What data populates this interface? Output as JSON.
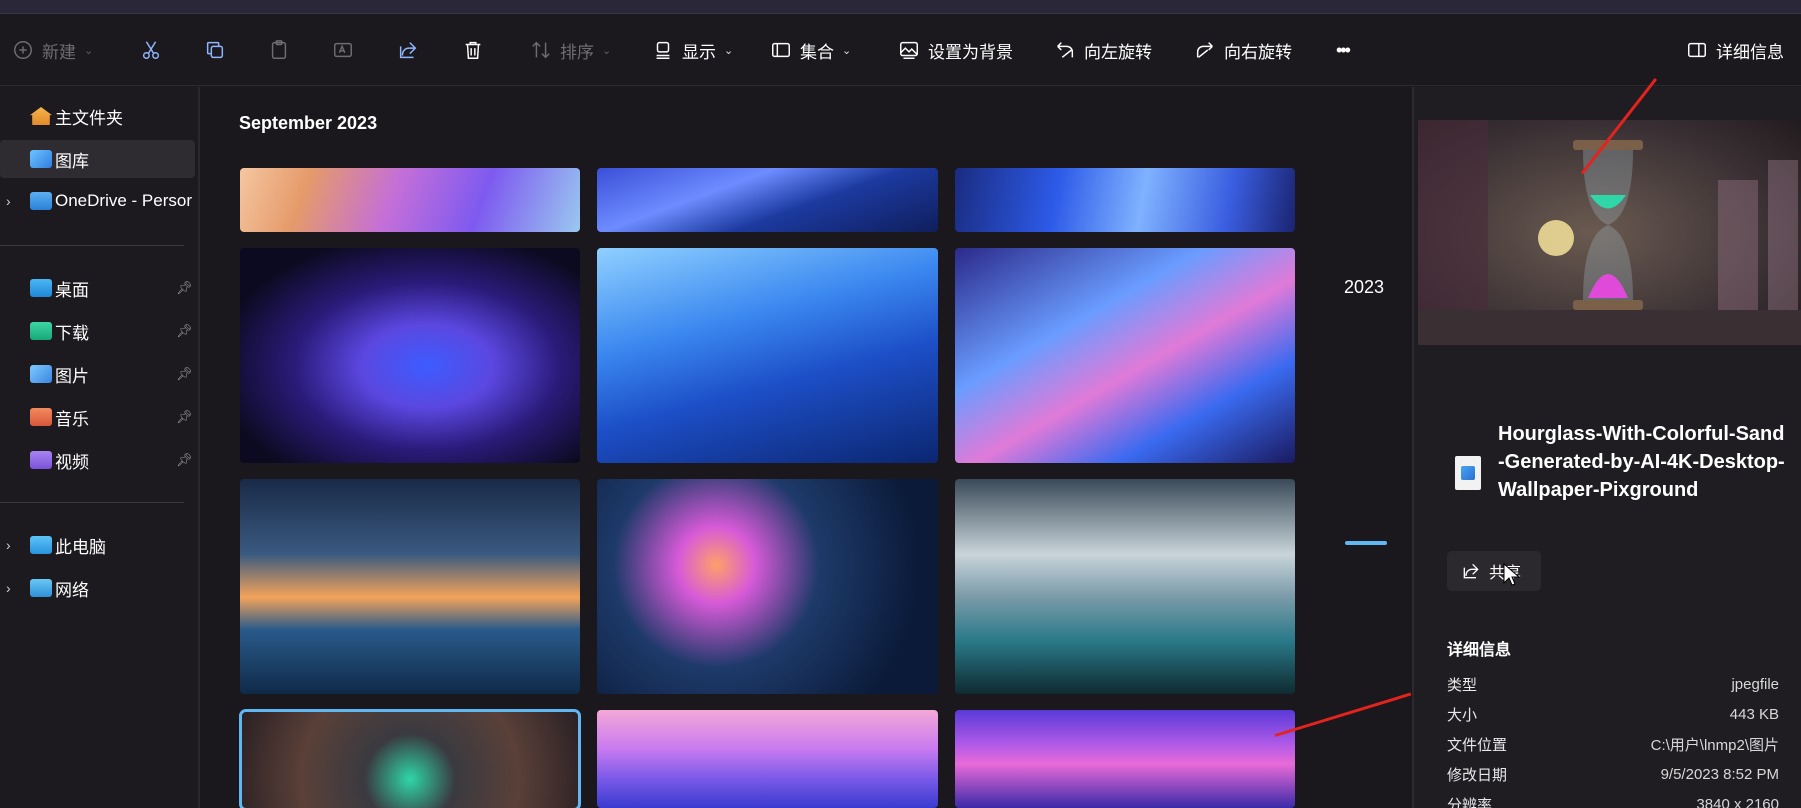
{
  "toolbar": {
    "new_label": "新建",
    "sort_label": "排序",
    "view_label": "显示",
    "collection_label": "集合",
    "set_background_label": "设置为背景",
    "rotate_left_label": "向左旋转",
    "rotate_right_label": "向右旋转",
    "more_label": "•••",
    "details_label": "详细信息"
  },
  "sidebar": {
    "items": [
      {
        "label": "主文件夹"
      },
      {
        "label": "图库"
      },
      {
        "label": "OneDrive - Persor"
      },
      {
        "label": "桌面"
      },
      {
        "label": "下载"
      },
      {
        "label": "图片"
      },
      {
        "label": "音乐"
      },
      {
        "label": "视频"
      },
      {
        "label": "此电脑"
      },
      {
        "label": "网络"
      }
    ]
  },
  "gallery": {
    "section_title": "September 2023",
    "year_label": "2023"
  },
  "details": {
    "file_name": "Hourglass-With-Colorful-Sand-Generated-by-AI-4K-Desktop-Wallpaper-Pixground",
    "share_label": "共享",
    "heading": "详细信息",
    "props": [
      {
        "key": "类型",
        "value": "jpegfile"
      },
      {
        "key": "大小",
        "value": "443 KB"
      },
      {
        "key": "文件位置",
        "value": "C:\\用户\\lnmp2\\图片"
      },
      {
        "key": "修改日期",
        "value": "9/5/2023 8:52 PM"
      },
      {
        "key": "分辨率",
        "value": "3840 x 2160"
      }
    ]
  },
  "colors": {
    "accent": "#5fb8f2",
    "annotation_arrow": "#e3231e"
  }
}
